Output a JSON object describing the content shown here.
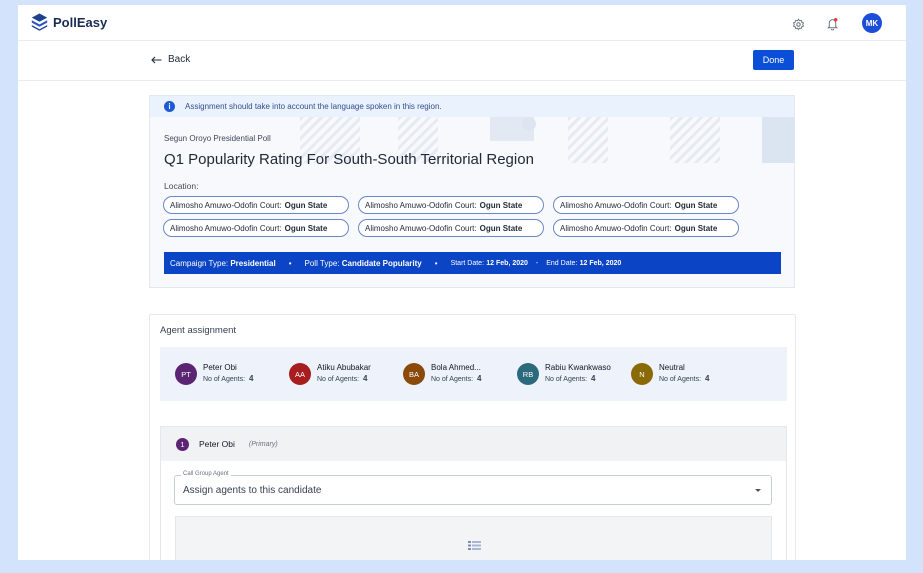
{
  "app": {
    "name": "PollEasy"
  },
  "header": {
    "user_initials": "MK"
  },
  "subbar": {
    "back_label": "Back",
    "done_label": "Done"
  },
  "poll": {
    "info_message": "Assignment should take into account the language spoken in this region.",
    "campaign_name": "Segun Oroyo Presidential Poll",
    "title": "Q1 Popularity Rating For South-South Territorial Region",
    "location_label": "Location:",
    "locations": [
      {
        "court": "Alimosho Amuwo-Odofin Court:",
        "state": "Ogun State"
      },
      {
        "court": "Alimosho Amuwo-Odofin Court:",
        "state": "Ogun State"
      },
      {
        "court": "Alimosho Amuwo-Odofin Court:",
        "state": "Ogun State"
      },
      {
        "court": "Alimosho Amuwo-Odofin Court:",
        "state": "Ogun State"
      },
      {
        "court": "Alimosho Amuwo-Odofin Court:",
        "state": "Ogun State"
      },
      {
        "court": "Alimosho Amuwo-Odofin Court:",
        "state": "Ogun State"
      }
    ],
    "meta": {
      "campaign_type_label": "Campaign Type:",
      "campaign_type": "Presidential",
      "poll_type_label": "Poll Type:",
      "poll_type": "Candidate Popularity",
      "start_label": "Start Date:",
      "start_date": "12 Feb, 2020",
      "dash": "-",
      "end_label": "End Date:",
      "end_date": "12 Feb, 2020"
    }
  },
  "agents": {
    "title": "Agent assignment",
    "count_label": "No of Agents:",
    "list": [
      {
        "initials": "PT",
        "name": "Peter Obi",
        "count": "4",
        "color": "#5b2574"
      },
      {
        "initials": "AA",
        "name": "Atiku Abubakar",
        "count": "4",
        "color": "#a81e1e"
      },
      {
        "initials": "BA",
        "name": "Bola Ahmed...",
        "count": "4",
        "color": "#8a4a0b"
      },
      {
        "initials": "RB",
        "name": "Rabiu Kwankwaso",
        "count": "4",
        "color": "#2b6a7d"
      },
      {
        "initials": "N",
        "name": "Neutral",
        "count": "4",
        "color": "#8a6a06"
      }
    ]
  },
  "candidate_panel": {
    "number": "1",
    "name": "Peter Obi",
    "tag": "(Primary)",
    "select_legend": "Call Group Agent",
    "select_value": "Assign agents to this candidate"
  }
}
